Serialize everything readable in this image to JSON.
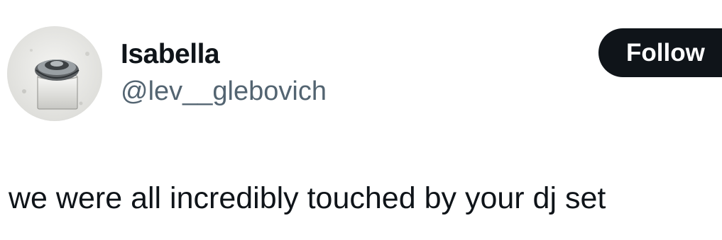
{
  "user": {
    "display_name": "Isabella",
    "handle": "@lev__glebovich"
  },
  "actions": {
    "follow_label": "Follow"
  },
  "tweet": {
    "text": "we were all incredibly touched by your dj set"
  },
  "colors": {
    "background": "#ffffff",
    "primary_text": "#0f1419",
    "secondary_text": "#536471",
    "button_background": "#0f1419",
    "button_text": "#ffffff"
  },
  "icons": {
    "avatar_image": "profile-photo-cloth-covered-object-icon"
  }
}
